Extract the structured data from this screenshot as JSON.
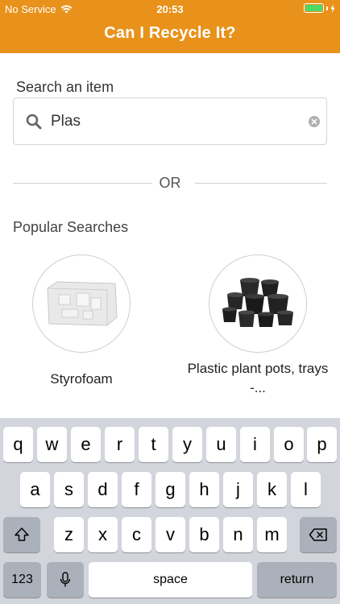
{
  "status_bar": {
    "carrier": "No Service",
    "time": "20:53"
  },
  "header": {
    "title": "Can I Recycle It?",
    "background_color": "#e8921b"
  },
  "search": {
    "label": "Search an item",
    "value": "Plas",
    "icon": "search-icon",
    "clear_icon": "clear-icon"
  },
  "divider": {
    "text": "OR"
  },
  "popular": {
    "title": "Popular Searches",
    "items": [
      {
        "label": "Styrofoam",
        "icon": "styrofoam-image"
      },
      {
        "label": "Plastic plant pots, trays -...",
        "icon": "plant-pots-image"
      }
    ]
  },
  "keyboard": {
    "row1": [
      "q",
      "w",
      "e",
      "r",
      "t",
      "y",
      "u",
      "i",
      "o",
      "p"
    ],
    "row2": [
      "a",
      "s",
      "d",
      "f",
      "g",
      "h",
      "j",
      "k",
      "l"
    ],
    "row3": [
      "z",
      "x",
      "c",
      "v",
      "b",
      "n",
      "m"
    ],
    "numbers_key": "123",
    "space_key": "space",
    "return_key": "return",
    "shift_icon": "shift-icon",
    "backspace_icon": "backspace-icon",
    "mic_icon": "microphone-icon"
  }
}
